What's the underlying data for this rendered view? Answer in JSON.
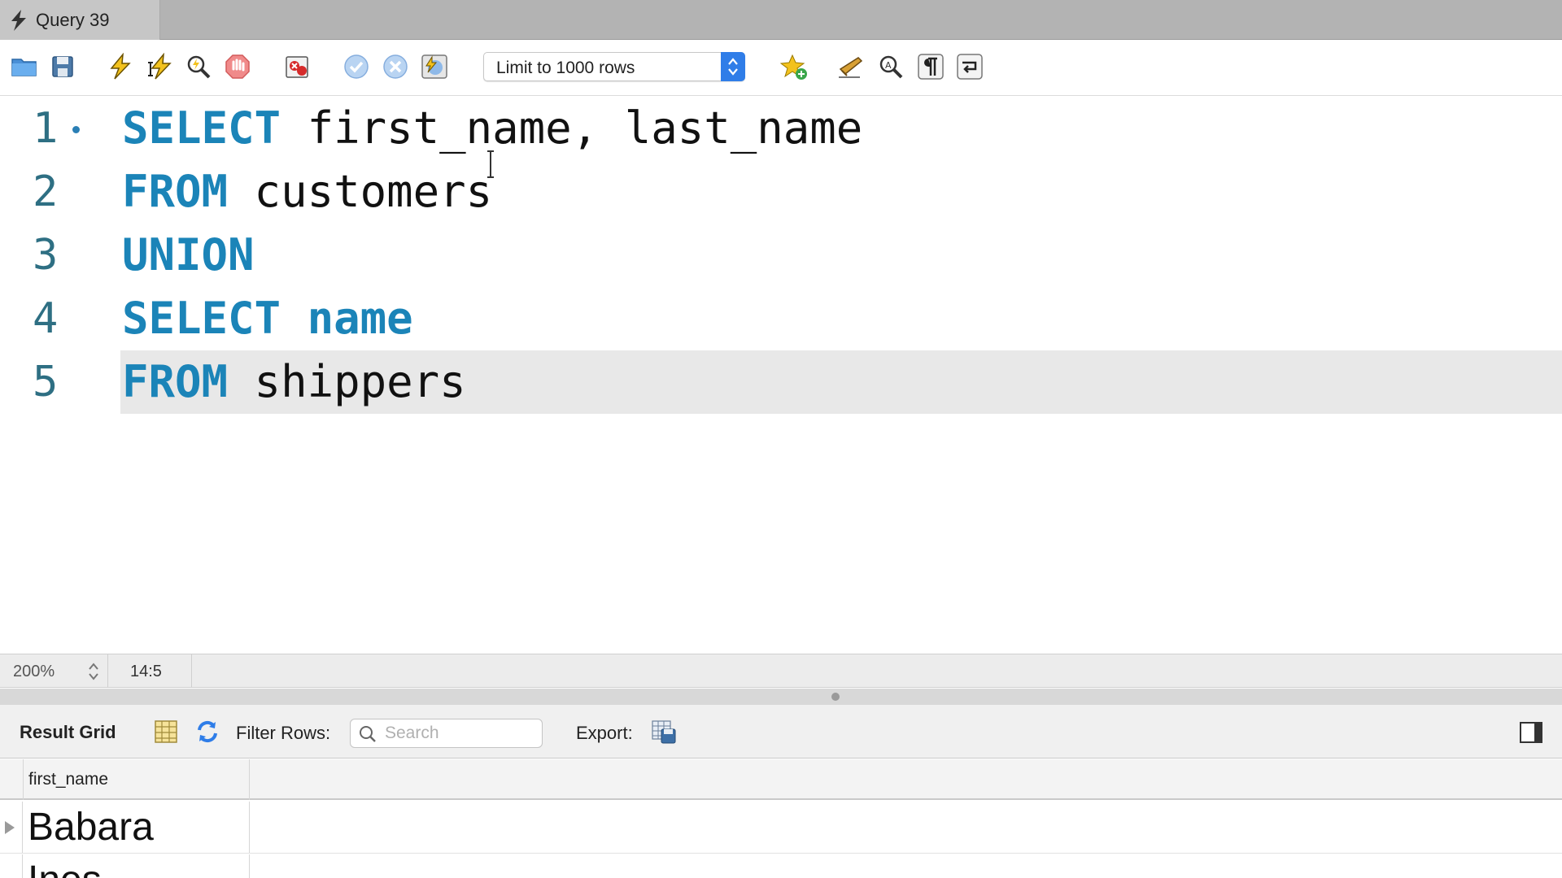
{
  "tab": {
    "title": "Query 39",
    "icon": "bolt-icon"
  },
  "toolbar": {
    "buttons": [
      {
        "name": "open-file-icon"
      },
      {
        "name": "save-icon"
      },
      {
        "name": "execute-icon"
      },
      {
        "name": "execute-current-icon"
      },
      {
        "name": "explain-icon"
      },
      {
        "name": "stop-icon"
      },
      {
        "name": "toggle-error-icon"
      },
      {
        "name": "commit-icon"
      },
      {
        "name": "rollback-icon"
      },
      {
        "name": "autocommit-icon"
      },
      {
        "name": "add-snippet-icon"
      },
      {
        "name": "beautify-icon"
      },
      {
        "name": "find-icon"
      },
      {
        "name": "invisible-chars-icon"
      },
      {
        "name": "word-wrap-icon"
      }
    ],
    "limit_select": {
      "value": "Limit to 1000 rows"
    }
  },
  "editor": {
    "lines": [
      {
        "num": "1",
        "tokens": [
          {
            "t": "SELECT",
            "kw": true
          },
          {
            "t": " first_name, last_name",
            "kw": false
          }
        ],
        "marker": true
      },
      {
        "num": "2",
        "tokens": [
          {
            "t": "FROM",
            "kw": true
          },
          {
            "t": " customers",
            "kw": false
          }
        ],
        "marker": false
      },
      {
        "num": "3",
        "tokens": [
          {
            "t": "UNION",
            "kw": true
          }
        ],
        "marker": false
      },
      {
        "num": "4",
        "tokens": [
          {
            "t": "SELECT",
            "kw": true
          },
          {
            "t": " ",
            "kw": false
          },
          {
            "t": "name",
            "kw": true
          }
        ],
        "marker": false
      },
      {
        "num": "5",
        "tokens": [
          {
            "t": "FROM",
            "kw": true
          },
          {
            "t": " shippers",
            "kw": false
          }
        ],
        "marker": false,
        "current": true
      }
    ],
    "keyword_color": "#1b84b8"
  },
  "status": {
    "zoom": "200%",
    "cursor_position": "14:5"
  },
  "result": {
    "title": "Result Grid",
    "filter_label": "Filter Rows:",
    "search_placeholder": "Search",
    "export_label": "Export:",
    "columns": [
      "first_name"
    ],
    "rows": [
      [
        "Babara"
      ],
      [
        "Ines"
      ]
    ]
  }
}
